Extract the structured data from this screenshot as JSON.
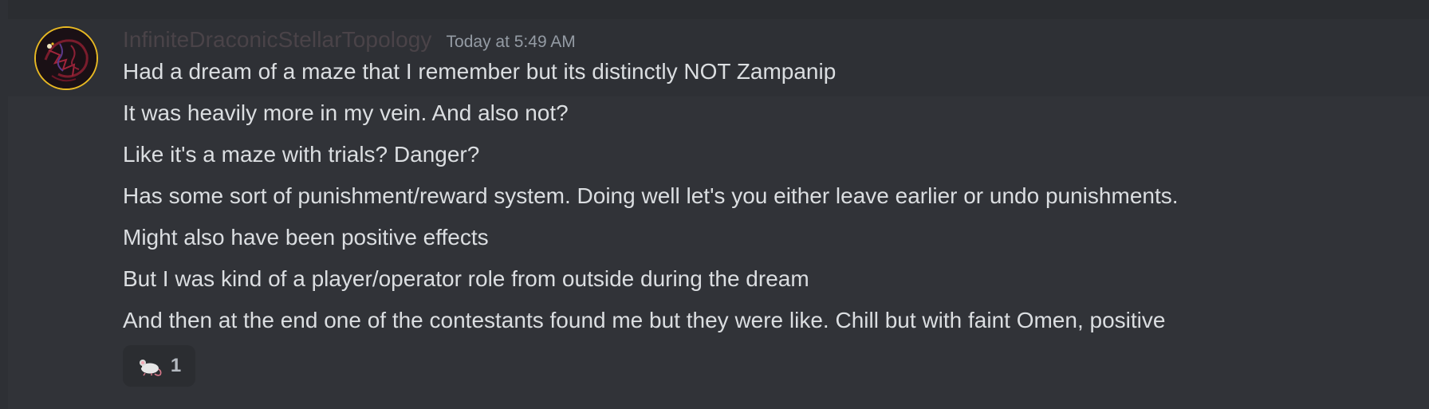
{
  "message": {
    "author": "InfiniteDraconicStellarTopology",
    "timestamp": "Today at 5:49 AM",
    "avatar_icon": "draconic-sigil-avatar",
    "lines": [
      "Had a dream of a maze that I remember but its distinctly NOT Zampanip",
      "It was heavily more in my vein. And also not?",
      "Like it's a maze with trials? Danger?",
      "Has some sort of punishment/reward system. Doing well let's you either leave earlier or undo punishments.",
      "Might also have been positive effects",
      "But I was kind of a player/operator role from outside during the dream",
      "And then at the end one of the contestants found me but they were like. Chill but with faint Omen, positive"
    ],
    "reaction": {
      "emoji": "mouse-emoji",
      "count": "1"
    }
  },
  "colors": {
    "background": "#313338",
    "hover_band": "#2e3035",
    "username": "#4a4348",
    "text": "#dbdee1",
    "timestamp": "#949ba4",
    "avatar_ring": "#e8b923"
  }
}
